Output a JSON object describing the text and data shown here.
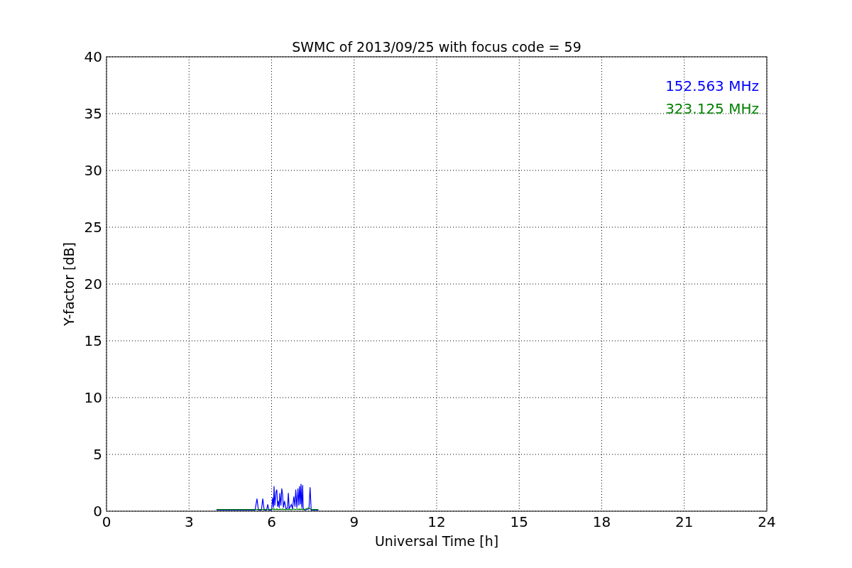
{
  "chart_data": {
    "type": "line",
    "title": "SWMC of 2013/09/25 with focus code = 59",
    "xlabel": "Universal Time [h]",
    "ylabel": "Y-factor [dB]",
    "x": [
      4.0,
      5.4,
      5.47,
      5.52,
      5.63,
      5.68,
      5.73,
      5.82,
      5.86,
      5.9,
      6.0,
      6.04,
      6.07,
      6.09,
      6.12,
      6.16,
      6.19,
      6.22,
      6.25,
      6.28,
      6.3,
      6.34,
      6.37,
      6.4,
      6.43,
      6.47,
      6.52,
      6.58,
      6.61,
      6.64,
      6.72,
      6.76,
      6.81,
      6.85,
      6.88,
      6.92,
      6.96,
      6.99,
      7.02,
      7.05,
      7.07,
      7.1,
      7.13,
      7.15,
      7.17,
      7.2,
      7.36,
      7.4,
      7.44,
      7.7
    ],
    "series": [
      {
        "name": "152.563 MHz",
        "color": "#0000ff",
        "values": [
          0.1,
          0.1,
          1.1,
          0.1,
          0.1,
          1.1,
          0.1,
          0.1,
          0.6,
          0.1,
          0.1,
          1.2,
          0.3,
          2.2,
          0.5,
          1.7,
          1.9,
          0.4,
          0.9,
          0.3,
          1.6,
          0.5,
          2.0,
          1.5,
          0.3,
          0.9,
          0.2,
          0.3,
          1.6,
          0.2,
          0.6,
          0.2,
          1.3,
          0.4,
          1.9,
          0.3,
          2.0,
          0.5,
          2.2,
          0.6,
          2.4,
          0.3,
          2.3,
          0.2,
          0.2,
          0.1,
          0.2,
          2.1,
          0.1,
          0.1
        ]
      },
      {
        "name": "323.125 MHz",
        "color": "#008000",
        "values": [
          0.15,
          0.15,
          0.15,
          0.15,
          0.15,
          0.15,
          0.15,
          0.15,
          0.15,
          0.15,
          0.15,
          0.2,
          0.15,
          0.2,
          0.15,
          0.15,
          0.2,
          0.15,
          0.15,
          0.15,
          0.2,
          0.15,
          0.15,
          0.2,
          0.15,
          0.15,
          0.15,
          0.15,
          0.2,
          0.15,
          0.15,
          0.15,
          0.2,
          0.15,
          0.15,
          0.2,
          0.15,
          0.15,
          0.2,
          0.15,
          0.15,
          0.2,
          0.15,
          0.15,
          0.15,
          0.15,
          0.3,
          0.2,
          0.15,
          0.15
        ]
      }
    ],
    "xlim": [
      0,
      24
    ],
    "ylim": [
      0,
      40
    ],
    "xticks": [
      0,
      3,
      6,
      9,
      12,
      15,
      18,
      21,
      24
    ],
    "yticks": [
      0,
      5,
      10,
      15,
      20,
      25,
      30,
      35,
      40
    ],
    "grid": true
  }
}
